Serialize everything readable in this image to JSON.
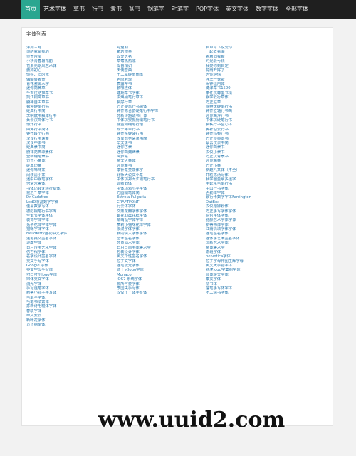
{
  "nav": {
    "items": [
      "首页",
      "艺术字体",
      "草书",
      "行书",
      "隶书",
      "篆书",
      "钢笔字",
      "毛笔字",
      "POP字体",
      "英文字体",
      "数字字体",
      "全部字体"
    ],
    "active_index": 0,
    "active_color": "#2aa690"
  },
  "panel": {
    "title": "字体列表",
    "columns": [
      [
        "浮如三月",
        "你的就是我的",
        "重查古房",
        "小桥青春暑花韵",
        "花果无期风艺术体",
        "要如初心",
        "你好、旧时光",
        "偶髓譬者景",
        "青花瓷黑木字",
        "迷你简黄草",
        "千石往结推草书",
        "凯江铜简草书",
        "腾禅自由草书",
        "锦迎硬笔行书",
        "经典行书简",
        "李明斌书飘体行书",
        "蔡云汉简体行书",
        "博洋行书",
        "四海行书简体",
        "钟齐段宁行书",
        "汉仪行书速篆",
        "汉仪中隶书",
        "经典隶书简",
        "腾祥范笑歌隶体",
        "全新硬笔隶书",
        "方正小篆体",
        "经典印篆",
        "迷你味味篆",
        "闹装清小篆",
        "迷中中钢笔字体",
        "悟清六美体",
        "书体坊钱沈钱行草体",
        "昆之千草字体",
        "Dr Carbfred",
        "LcdD液晶数字字体",
        "佳易数字写体",
        "德彪钢笔行书字库",
        "圣诞节字体字体",
        "装饰字体字体",
        "兔子花体字体字体",
        "猫咪字体字体",
        "HelloKitty猫花中文字体",
        "连笔英文签名字体",
        "迷魔字体",
        "日月传书艺术字体",
        "仿古代字体",
        "名字设计签名字体",
        "英文手写字体",
        "Google 字体",
        "英文字母手写体",
        "可口可乐logo字体",
        "宋体英文字体",
        "流光字体",
        "手写连笔字体",
        "新蒂小丸子手写体",
        "毛笔字字体",
        "毛笔书法繁体",
        "苏新诗毛糙体字体",
        "春联字体",
        "毕文安云",
        "新叶花字体",
        "方正钢笔体"
      ],
      [
        "丹兔助",
        "麝若惯量",
        "以爱之名",
        "草莓热热戚",
        "似曾相识",
        "天使恋曲",
        "十二章碎雨雨落",
        "若隐若现",
        "表露苹书",
        "鹏哪连体",
        "建期草书字体",
        "洪焕硬笔行草体",
        "良好行草",
        "方正硬笔行书简体",
        "钟齐陈合韵硬笔行书字库",
        "苏新诗豁硫书行体",
        "书体坊安颜厨钢笔行书",
        "徐金如硬笔行楷",
        "现宁苹草行书",
        "钟齐余好硬行书",
        "汉仪范芜朵隶书简",
        "华文隶书",
        "迷你古隶",
        "迷你简魏碑隶",
        "简步篆",
        "金文大篆体",
        "迷你篆书",
        "康针篆变篆体字",
        "北师大说文小篆",
        "书体坊郑九江钢笔行书",
        "郭敬韵体",
        "书体坊邓小平字体",
        "方圆钢笔体简",
        "Estrela Fulguria",
        "CRAFTFONT",
        "行云体字体",
        "文鼎花瓣字体字体",
        "繁花幻晨花样字体",
        "萌萌哒字体字体",
        "萝莉小猫咪花体字体",
        "浪漫字体字体",
        "我的情人字体字体",
        "艺术签名字体",
        "苏黄仙水字体",
        "日月日雨书体美术字",
        "包装设计字体",
        "英文个性签名字体",
        "拉丁文字体",
        "连笔流光字体",
        "迪士尼logo字体",
        "Monaco",
        "IOS7 系统字体",
        "颜所可爱字体",
        "李国夫手写体",
        "汉仪丫丫体手写体"
      ],
      [
        "百草草下说爱你",
        "一起去看海",
        "看着同我握",
        "时光会亏钱",
        "我爱你到日定",
        "花雨开好了",
        "为你钟情",
        "浮华一世歌",
        "闹钟运用体",
        "博洋草书1500",
        "李任杭尊墨书法",
        "钢学云行草体",
        "方正狂草",
        "陈继世硬笔行书",
        "钟齐立轴行书简",
        "迷你简浮行书",
        "书体坊硬笔行书",
        "良秩行书空心体",
        "腾祥伯云行书",
        "钟齐杨香行书",
        "方正淡墨隶书",
        "蔡云汉隶书简",
        "迷你简隶书",
        "汉仪小隶书",
        "方正汉青隶书",
        "迷你简篆",
        "方正小篆",
        "新趣八篆体（不全）",
        "井粒陈汤写体",
        "我学图金拿多迷字",
        "毛延东毛笔行书",
        "中山行书字体",
        "否勤体字体",
        "锁行卡数字字体Farrington",
        "DatBox",
        "汉仪楷娜粉体",
        "方正手写字体字体",
        "花哲字体字体",
        "雅颜艺术字体字体",
        "新蒂书体字体",
        "江南情歌字体字体",
        "连笔签名字体",
        "连体字艺术签名字体",
        "国新艺术字体",
        "金体美术字",
        "谢斑字体",
        "helvetica字体",
        "拉丁字母作图生辉字母",
        "英文大学指字体",
        "雅虎logo字集图字体",
        "圆体英文字体",
        "泰文字体",
        "情书体",
        "信笔手写体字体",
        "不二情书字体"
      ]
    ]
  },
  "watermark": {
    "text": "www.uuid2.com"
  }
}
